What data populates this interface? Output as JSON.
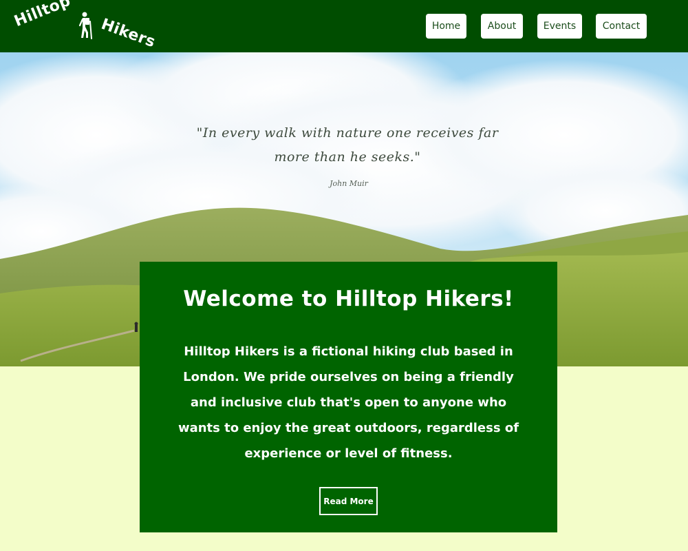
{
  "header": {
    "logo": {
      "word_left": "Hilltop",
      "word_right": "Hikers",
      "icon": "hiker-icon"
    },
    "nav": [
      {
        "label": "Home"
      },
      {
        "label": "About"
      },
      {
        "label": "Events"
      },
      {
        "label": "Contact"
      }
    ]
  },
  "hero": {
    "quote": "\"In every walk with nature one receives far more than he seeks.\"",
    "author": "John Muir"
  },
  "welcome": {
    "title": "Welcome to Hilltop Hikers!",
    "body": "Hilltop Hikers is a fictional hiking club based in London. We pride ourselves on being a friendly and inclusive club that's open to anyone who wants to enjoy the great outdoors, regardless of experience or level of fitness.",
    "button": "Read More"
  },
  "colors": {
    "header_bg": "#004d00",
    "card_bg": "#006400",
    "page_bg": "#f3fdc9",
    "nav_text": "#1b4d1b"
  }
}
